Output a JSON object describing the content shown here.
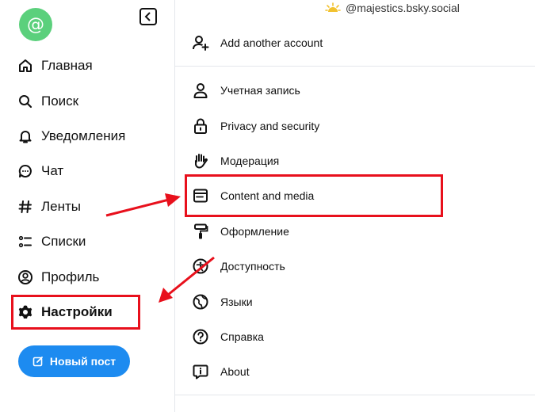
{
  "account": {
    "handle": "@majestics.bsky.social",
    "avatar_glyph": "@"
  },
  "sidebar": {
    "items": [
      {
        "label": "Главная",
        "icon": "home-icon"
      },
      {
        "label": "Поиск",
        "icon": "search-icon"
      },
      {
        "label": "Уведомления",
        "icon": "bell-icon"
      },
      {
        "label": "Чат",
        "icon": "chat-icon"
      },
      {
        "label": "Ленты",
        "icon": "hash-icon"
      },
      {
        "label": "Списки",
        "icon": "list-icon"
      },
      {
        "label": "Профиль",
        "icon": "profile-icon"
      },
      {
        "label": "Настройки",
        "icon": "gear-icon"
      }
    ],
    "new_post_label": "Новый пост"
  },
  "settings": {
    "add_account_label": "Add another account",
    "items": [
      {
        "label": "Учетная запись",
        "icon": "person-icon"
      },
      {
        "label": "Privacy and security",
        "icon": "lock-icon"
      },
      {
        "label": "Модерация",
        "icon": "hand-icon"
      },
      {
        "label": "Content and media",
        "icon": "window-icon"
      },
      {
        "label": "Оформление",
        "icon": "paint-roller-icon"
      },
      {
        "label": "Доступность",
        "icon": "accessibility-icon"
      },
      {
        "label": "Языки",
        "icon": "language-icon"
      },
      {
        "label": "Справка",
        "icon": "help-icon"
      },
      {
        "label": "About",
        "icon": "info-icon"
      }
    ]
  },
  "colors": {
    "accent": "#1d8bf0",
    "highlight": "#e8101c",
    "avatar": "#5bd07c"
  }
}
